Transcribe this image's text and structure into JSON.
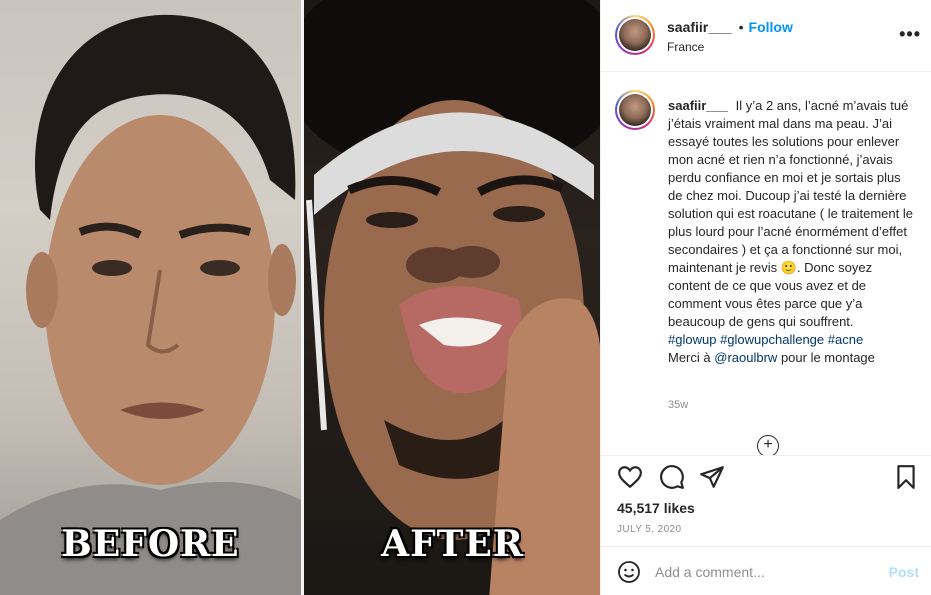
{
  "media": {
    "before_label": "BEFORE",
    "after_label": "AFTER"
  },
  "header": {
    "username": "saafiir___",
    "separator": "•",
    "follow_label": "Follow",
    "location": "France",
    "more_icon": "more-options-icon"
  },
  "caption": {
    "username": "saafiir___",
    "text_1": "Il y’a 2 ans, l’acné m’avais tué j’étais vraiment mal dans ma peau. J’ai essayé toutes les solutions pour enlever mon acné et rien n’a fonctionné, j’avais perdu confiance en moi et je sortais plus de chez moi. Ducoup j’ai testé la dernière solution qui est roacutane ( le traitement le plus lourd pour l’acné énormément d’effet secondaires ) et ça a fonctionné sur moi, maintenant je revis",
    "emoji": "🙂",
    "text_2": ". Donc soyez content de ce que vous avez et de comment vous êtes parce que y’a beaucoup de gens qui souffrent.",
    "hashtags": [
      "#glowup",
      "#glowupchallenge",
      "#acne"
    ],
    "credit_prefix": "Merci à",
    "credit_mention": "@raoulbrw",
    "credit_suffix": "pour le montage",
    "timestamp": "35w",
    "load_more_icon": "plus-circle-icon"
  },
  "actions": {
    "icons": [
      "heart-icon",
      "comment-icon",
      "share-icon",
      "bookmark-icon"
    ],
    "likes": "45,517 likes",
    "date": "JULY 5, 2020"
  },
  "comment_box": {
    "emoji_icon": "smiley-icon",
    "placeholder": "Add a comment...",
    "post_label": "Post"
  },
  "colors": {
    "accent": "#0095f6",
    "post_disabled": "#b2dffc",
    "text": "#262626",
    "muted": "#8e8e8e",
    "link": "#00376b"
  }
}
